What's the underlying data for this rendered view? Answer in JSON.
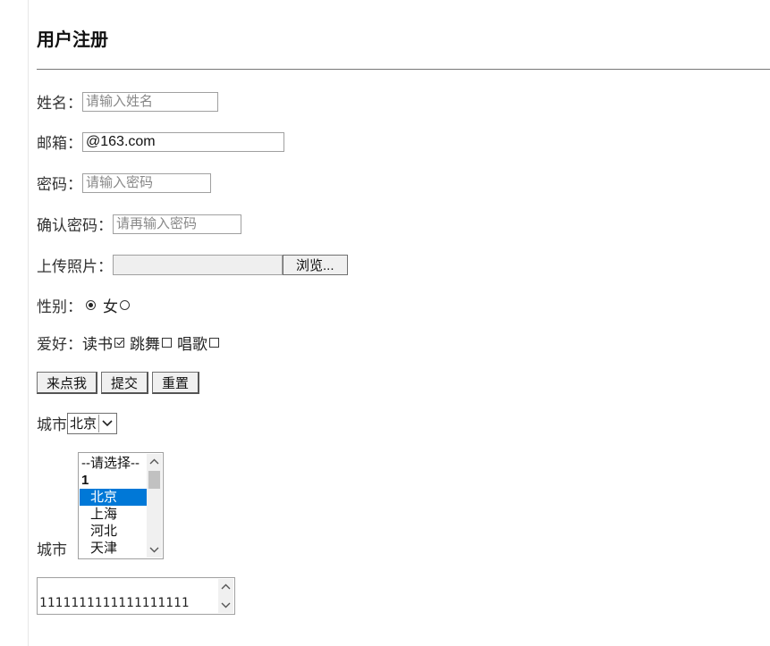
{
  "page_title": "用户注册",
  "form": {
    "name": {
      "label": "姓名：",
      "placeholder": "请输入姓名",
      "value": ""
    },
    "email": {
      "label": "邮箱：",
      "value": "@163.com"
    },
    "password": {
      "label": "密码：",
      "placeholder": "请输入密码"
    },
    "confirm_password": {
      "label": "确认密码：",
      "placeholder": "请再输入密码"
    },
    "photo": {
      "label": "上传照片：",
      "browse_label": "浏览..."
    },
    "gender": {
      "label": "性别：",
      "options": [
        {
          "label": "",
          "checked": true
        },
        {
          "label": "女",
          "checked": false
        }
      ]
    },
    "hobbies": {
      "label": "爱好：",
      "options": [
        {
          "label": "读书",
          "checked": true
        },
        {
          "label": "跳舞",
          "checked": false
        },
        {
          "label": "唱歌",
          "checked": false
        }
      ]
    },
    "buttons": {
      "click_me": "来点我",
      "submit": "提交",
      "reset": "重置"
    },
    "city_dropdown": {
      "label": "城市",
      "selected": "北京"
    },
    "city_listbox": {
      "label": "城市",
      "items": [
        "--请选择--",
        "1",
        "北京",
        "上海",
        "河北",
        "天津"
      ],
      "selected": "北京"
    },
    "textarea": {
      "value": "1111111111111111111"
    }
  }
}
